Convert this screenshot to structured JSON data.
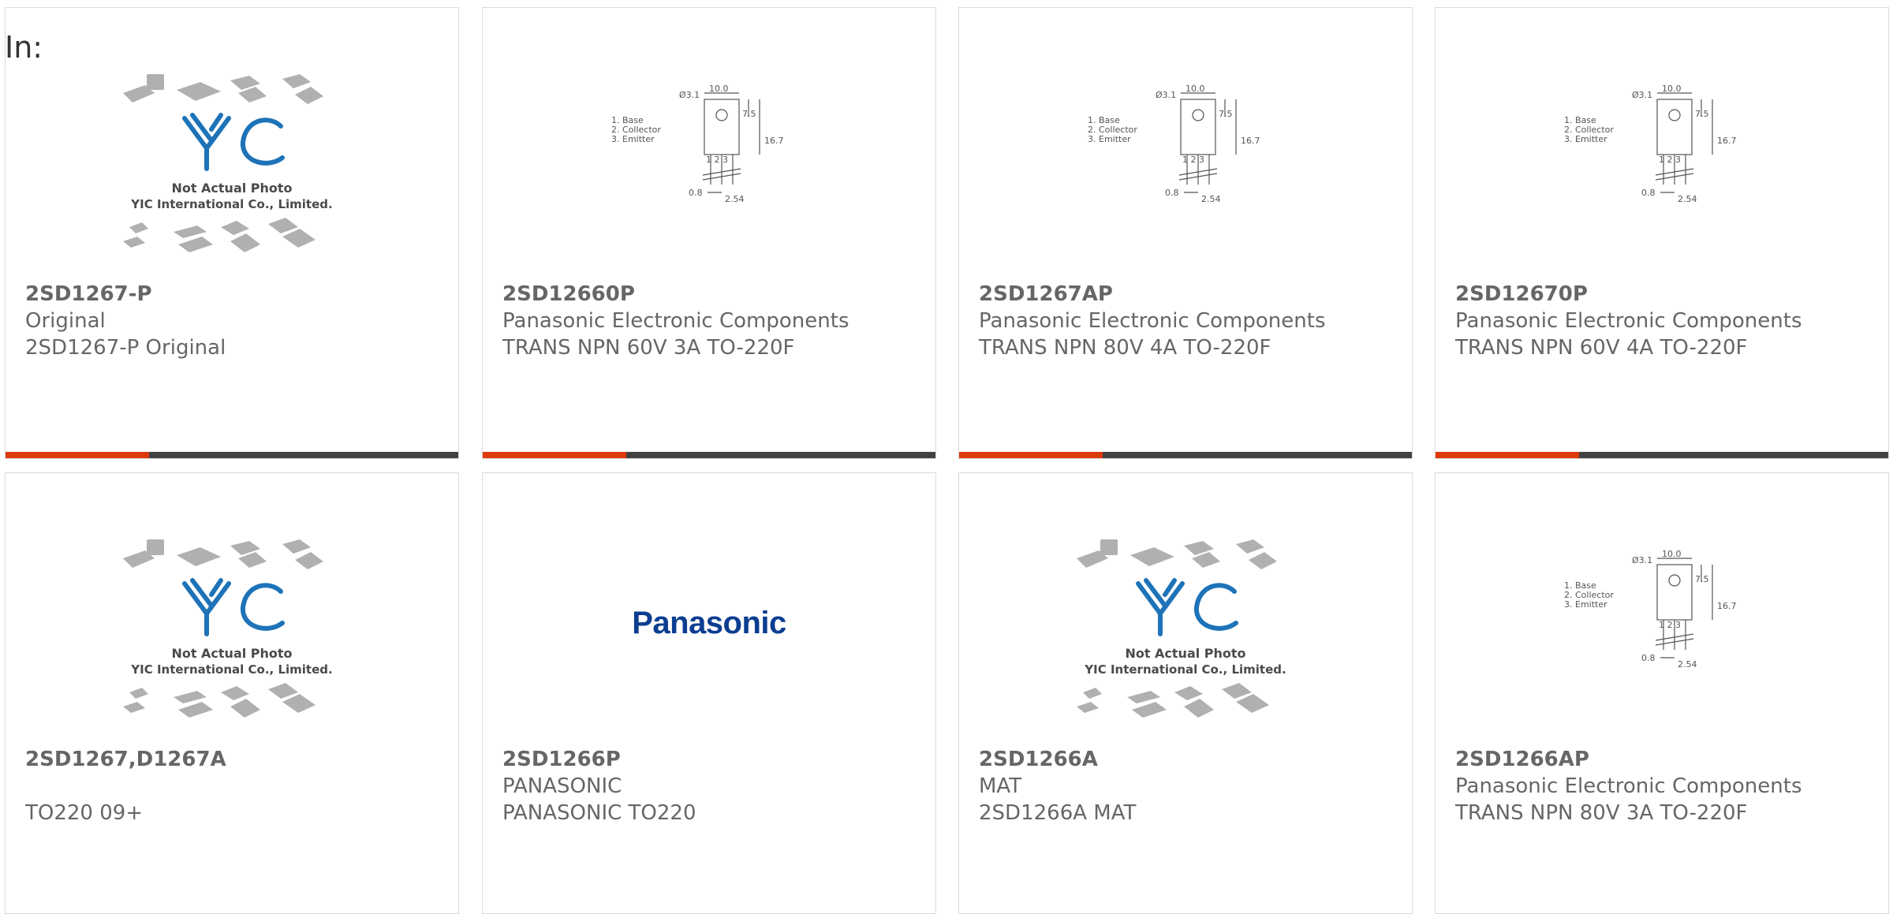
{
  "header": {
    "in_label": "In:"
  },
  "products": [
    {
      "image": "yic-placeholder",
      "image_text": [
        "Not Actual Photo",
        "YIC International Co., Limited."
      ],
      "name": "2SD1267-P",
      "maker": "Original",
      "desc": "2SD1267-P Original"
    },
    {
      "image": "to220-diagram",
      "name": "2SD12660P",
      "maker": "Panasonic Electronic Components",
      "desc": "TRANS NPN 60V 3A TO-220F"
    },
    {
      "image": "to220-diagram",
      "name": "2SD1267AP",
      "maker": "Panasonic Electronic Components",
      "desc": "TRANS NPN 80V 4A TO-220F"
    },
    {
      "image": "to220-diagram",
      "name": "2SD12670P",
      "maker": "Panasonic Electronic Components",
      "desc": "TRANS NPN 60V 4A TO-220F"
    },
    {
      "image": "yic-placeholder",
      "image_text": [
        "Not Actual Photo",
        "YIC International Co., Limited."
      ],
      "name": "2SD1267,D1267A",
      "maker": "",
      "desc": "TO220 09+"
    },
    {
      "image": "panasonic-logo",
      "logo_text": "Panasonic",
      "name": "2SD1266P",
      "maker": "PANASONIC",
      "desc": "PANASONIC TO220"
    },
    {
      "image": "yic-placeholder",
      "image_text": [
        "Not Actual Photo",
        "YIC International Co., Limited."
      ],
      "name": "2SD1266A",
      "maker": "MAT",
      "desc": "2SD1266A MAT"
    },
    {
      "image": "to220-diagram",
      "name": "2SD1266AP",
      "maker": "Panasonic Electronic Components",
      "desc": "TRANS NPN 80V 3A TO-220F"
    }
  ],
  "diagram_labels": {
    "pins": [
      "1. Base",
      "2. Collector",
      "3. Emitter"
    ],
    "dims": [
      "Ø3.1",
      "10.0",
      "7.5",
      "16.7",
      "1 2 3",
      "0.8",
      "2.54"
    ]
  },
  "colors": {
    "accent": "#dd3a0b",
    "bar": "#424242",
    "border": "#dadada",
    "text": "#666666",
    "logo_blue": "#0b3d91",
    "yic_blue": "#1e73b8"
  }
}
